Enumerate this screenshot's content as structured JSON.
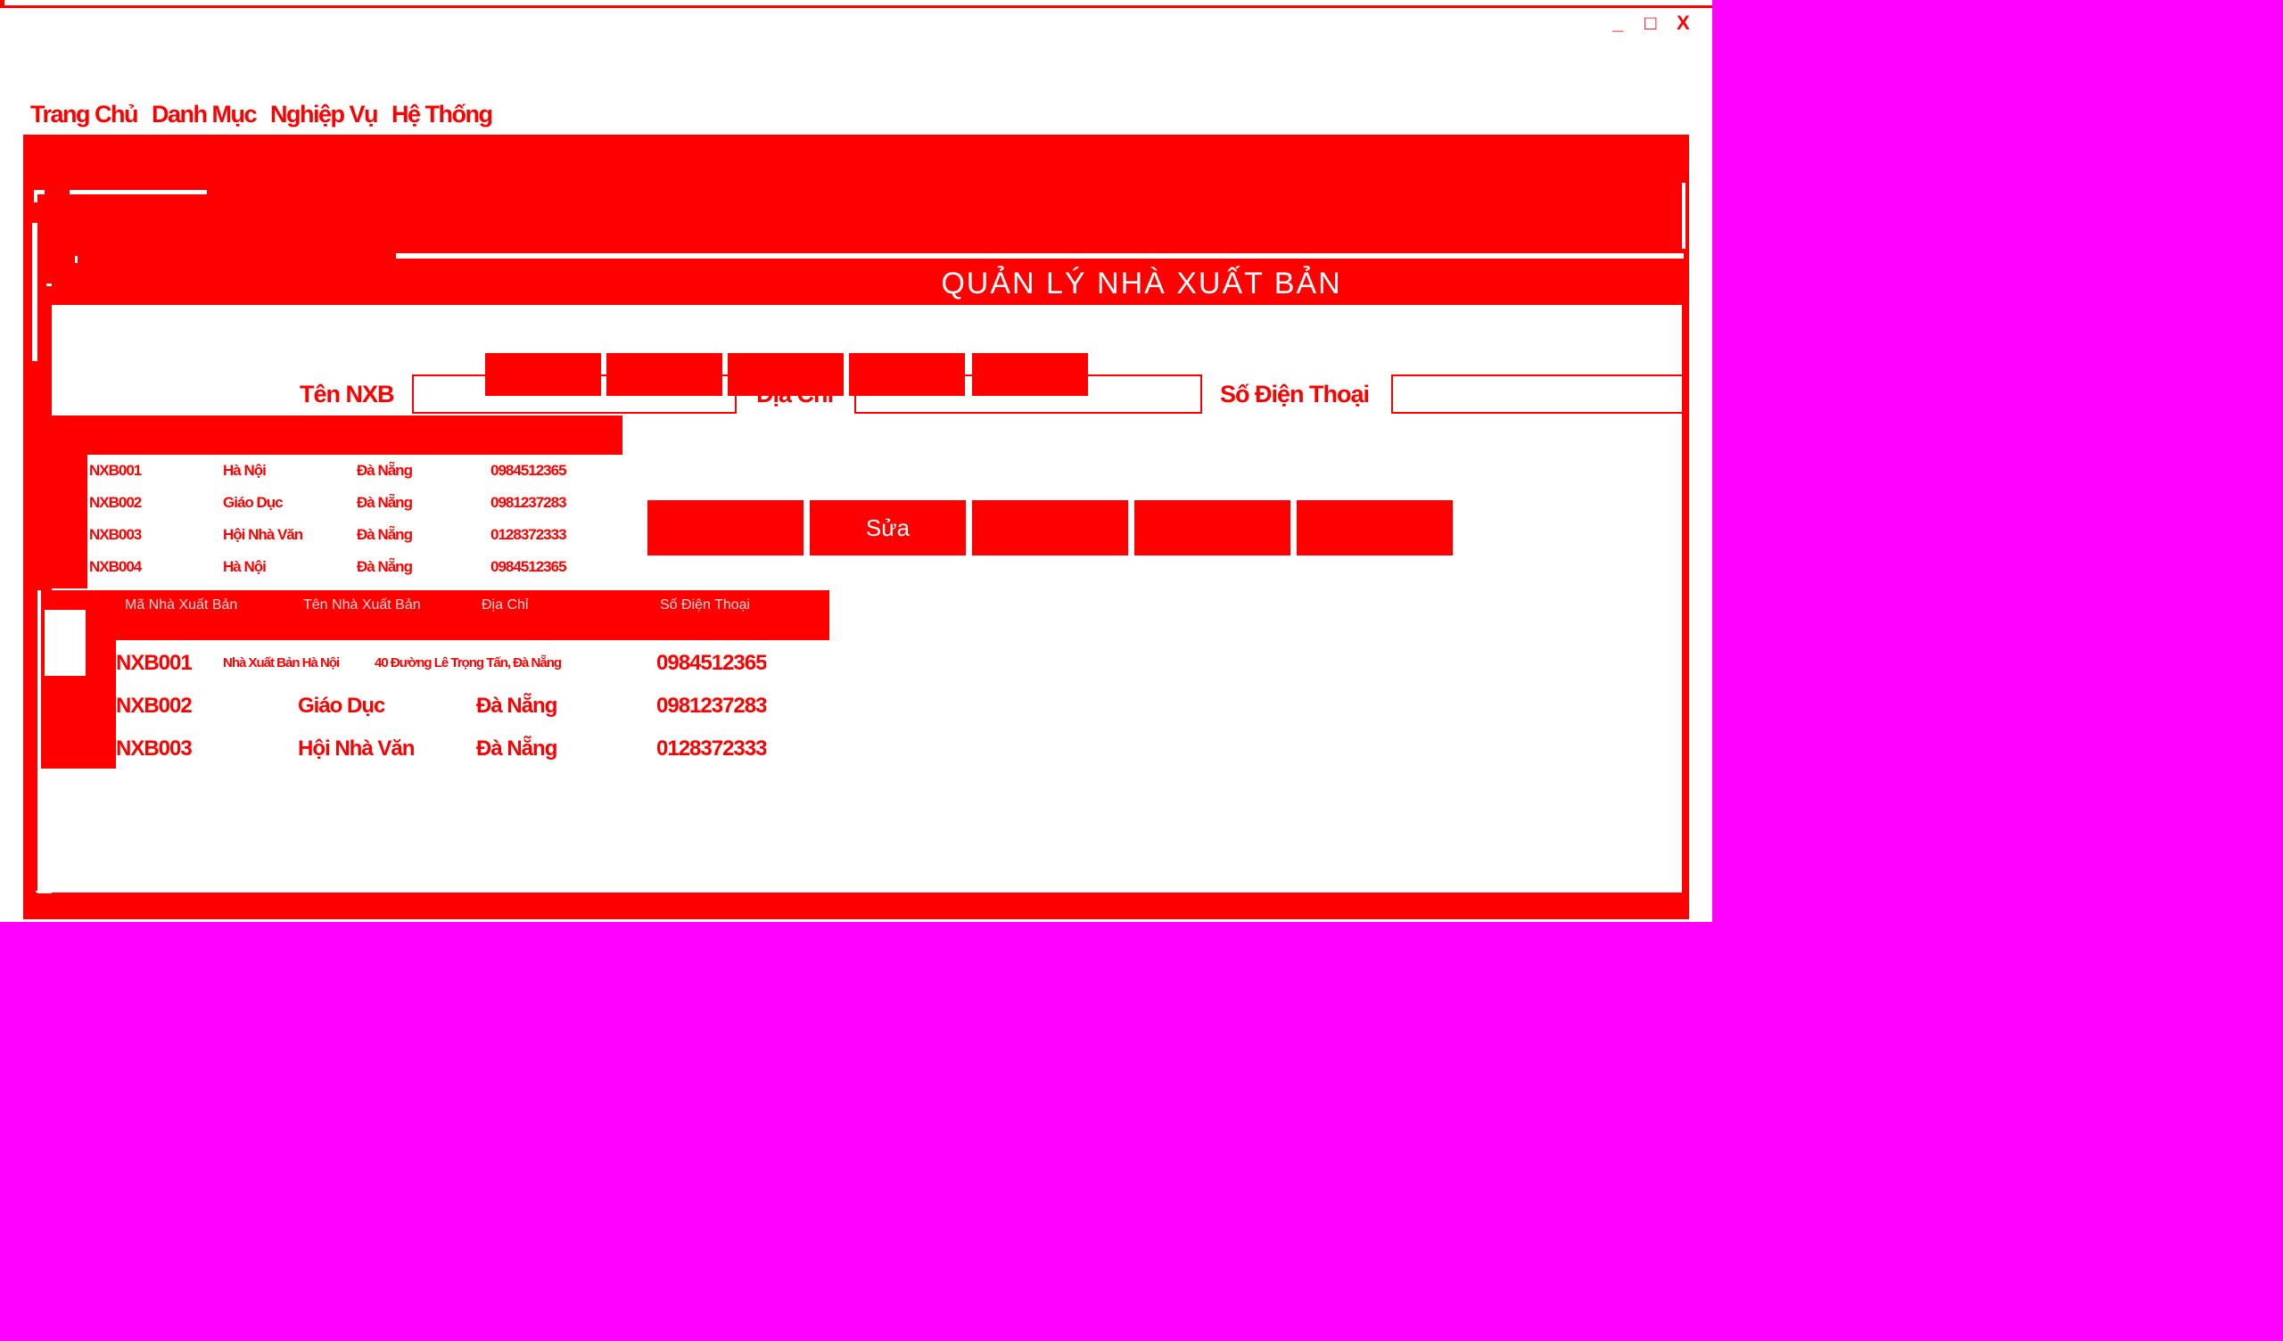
{
  "window": {
    "controls": {
      "minimize": "_",
      "maximize": "□",
      "close": "X"
    }
  },
  "menu": [
    "Trang Chủ",
    "Danh Mục",
    "Nghiệp Vụ",
    "Hệ Thống"
  ],
  "page_title": "QUẢN LÝ NHÀ XUẤT BẢN",
  "form": {
    "ten_label": "Tên NXB",
    "dia_chi_label": "Địa Chỉ",
    "sdt_label": "Số Điện Thoại",
    "ten_value": "",
    "dia_chi_value": "",
    "sdt_value": ""
  },
  "toolbar_buttons": [
    "",
    "",
    "",
    "",
    ""
  ],
  "action_buttons": [
    "",
    "Sửa",
    "",
    "",
    ""
  ],
  "small_list": [
    {
      "ma": "NXB001",
      "ten": "Hà Nội",
      "dia_chi": "Đà Nẵng",
      "sdt": "0984512365"
    },
    {
      "ma": "NXB002",
      "ten": "Giáo Dục",
      "dia_chi": "Đà Nẵng",
      "sdt": "0981237283"
    },
    {
      "ma": "NXB003",
      "ten": "Hội Nhà Văn",
      "dia_chi": "Đà Nẵng",
      "sdt": "0128372333"
    },
    {
      "ma": "NXB004",
      "ten": "Hà Nội",
      "dia_chi": "Đà Nẵng",
      "sdt": "0984512365"
    }
  ],
  "grid": {
    "headers": [
      "Mã Nhà Xuất Bản",
      "Tên Nhà Xuất Bản",
      "Địa Chỉ",
      "Số Điện Thoại"
    ],
    "rows": [
      {
        "ma": "NXB001",
        "ten": "Nhà Xuất Bản Hà Nội",
        "dia_chi": "40 Đường Lê Trọng Tấn, Đà Nẵng",
        "sdt": "0984512365"
      },
      {
        "ma": "NXB002",
        "ten": "Giáo Dục",
        "dia_chi": "Đà Nẵng",
        "sdt": "0981237283"
      },
      {
        "ma": "NXB003",
        "ten": "Hội Nhà Văn",
        "dia_chi": "Đà Nẵng",
        "sdt": "0128372333"
      }
    ]
  },
  "colors": {
    "accent": "#FF0000",
    "background": "#FF00FF",
    "window": "#FFFFFF"
  }
}
